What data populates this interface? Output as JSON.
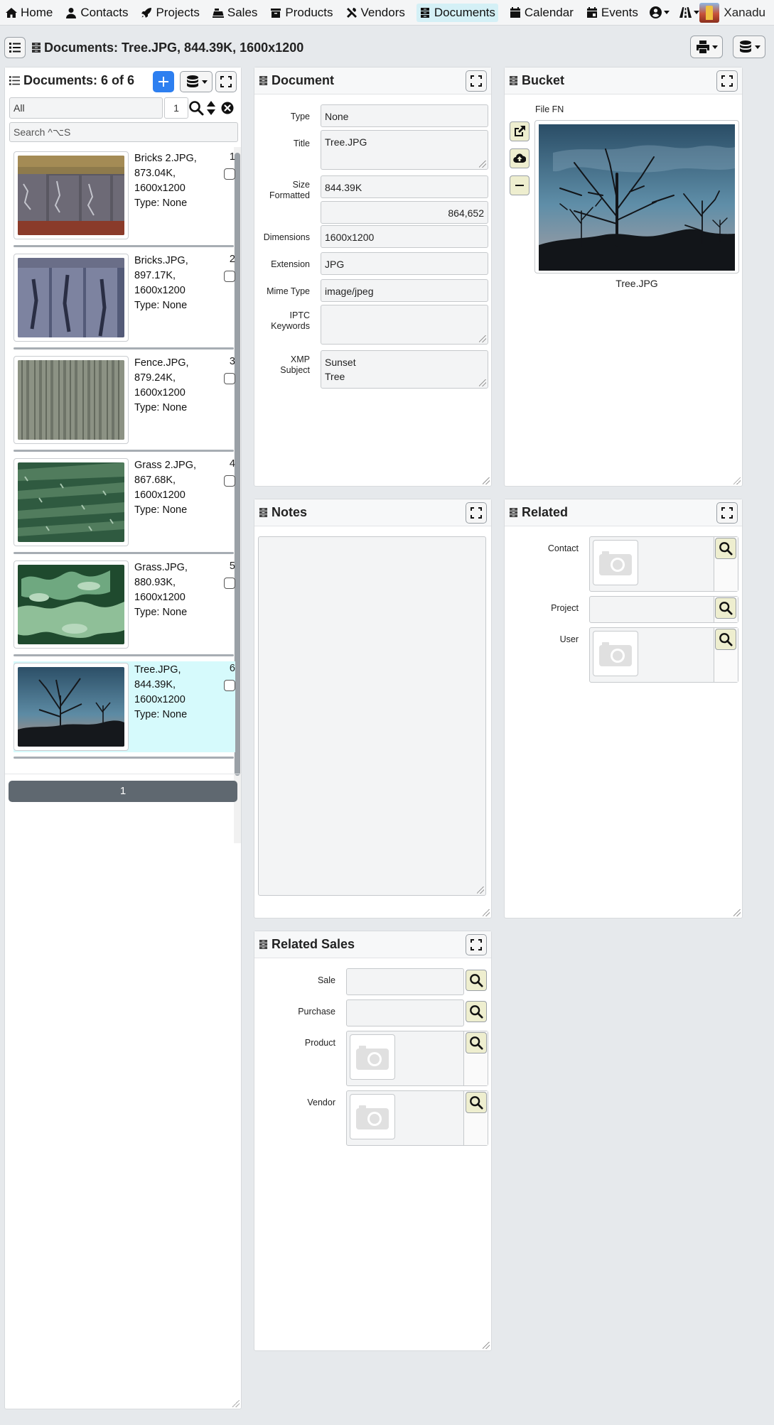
{
  "nav": {
    "items": [
      {
        "label": "Home",
        "icon": "home-icon"
      },
      {
        "label": "Contacts",
        "icon": "person-icon"
      },
      {
        "label": "Projects",
        "icon": "rocket-icon"
      },
      {
        "label": "Sales",
        "icon": "cash-register-icon"
      },
      {
        "label": "Products",
        "icon": "box-icon"
      },
      {
        "label": "Vendors",
        "icon": "tools-icon"
      },
      {
        "label": "Documents",
        "icon": "archive-icon"
      },
      {
        "label": "Calendar",
        "icon": "calendar-icon"
      },
      {
        "label": "Events",
        "icon": "calendar-event-icon"
      }
    ],
    "active": "Documents",
    "user_name": "Xanadu"
  },
  "title": {
    "text": "Documents: Tree.JPG, 844.39K, 1600x1200"
  },
  "list": {
    "title": "Documents: 6 of 6",
    "filter_value": "All",
    "page_input": "1",
    "search_placeholder": "Search ^⌥S",
    "items": [
      {
        "name": "Bricks 2.JPG,",
        "size": "873.04K,",
        "dims": "1600x1200",
        "type": "Type: None",
        "num": "1"
      },
      {
        "name": "Bricks.JPG,",
        "size": "897.17K,",
        "dims": "1600x1200",
        "type": "Type: None",
        "num": "2"
      },
      {
        "name": "Fence.JPG,",
        "size": "879.24K,",
        "dims": "1600x1200",
        "type": "Type: None",
        "num": "3"
      },
      {
        "name": "Grass 2.JPG,",
        "size": "867.68K,",
        "dims": "1600x1200",
        "type": "Type: None",
        "num": "4"
      },
      {
        "name": "Grass.JPG,",
        "size": "880.93K,",
        "dims": "1600x1200",
        "type": "Type: None",
        "num": "5"
      },
      {
        "name": "Tree.JPG,",
        "size": "844.39K,",
        "dims": "1600x1200",
        "type": "Type: None",
        "num": "6"
      }
    ],
    "selected_index": 5,
    "pager_label": "1"
  },
  "document": {
    "panel_title": "Document",
    "type_label": "Type",
    "type_value": "None",
    "title_label": "Title",
    "title_value": "Tree.JPG",
    "size_label_1": "Size",
    "size_label_2": "Formatted",
    "size_formatted": "844.39K",
    "size_bytes": "864,652",
    "dimensions_label": "Dimensions",
    "dimensions_value": "1600x1200",
    "extension_label": "Extension",
    "extension_value": "JPG",
    "mime_label": "Mime Type",
    "mime_value": "image/jpeg",
    "iptc_label_1": "IPTC",
    "iptc_label_2": "Keywords",
    "iptc_value": "",
    "xmp_label_1": "XMP",
    "xmp_label_2": "Subject",
    "xmp_line_1": "Sunset",
    "xmp_line_2": "Tree"
  },
  "bucket": {
    "panel_title": "Bucket",
    "file_label": "File FN",
    "file_name": "Tree.JPG"
  },
  "notes": {
    "panel_title": "Notes",
    "value": ""
  },
  "related": {
    "panel_title": "Related",
    "contact_label": "Contact",
    "project_label": "Project",
    "user_label": "User"
  },
  "related_sales": {
    "panel_title": "Related Sales",
    "sale_label": "Sale",
    "purchase_label": "Purchase",
    "product_label": "Product",
    "vendor_label": "Vendor"
  },
  "colors": {
    "accent_blue": "#2d7ff0",
    "selected_row": "#d6fafc",
    "nav_active": "#d4f0f6",
    "pager": "#5f6870",
    "search_button": "#eeeecf"
  }
}
